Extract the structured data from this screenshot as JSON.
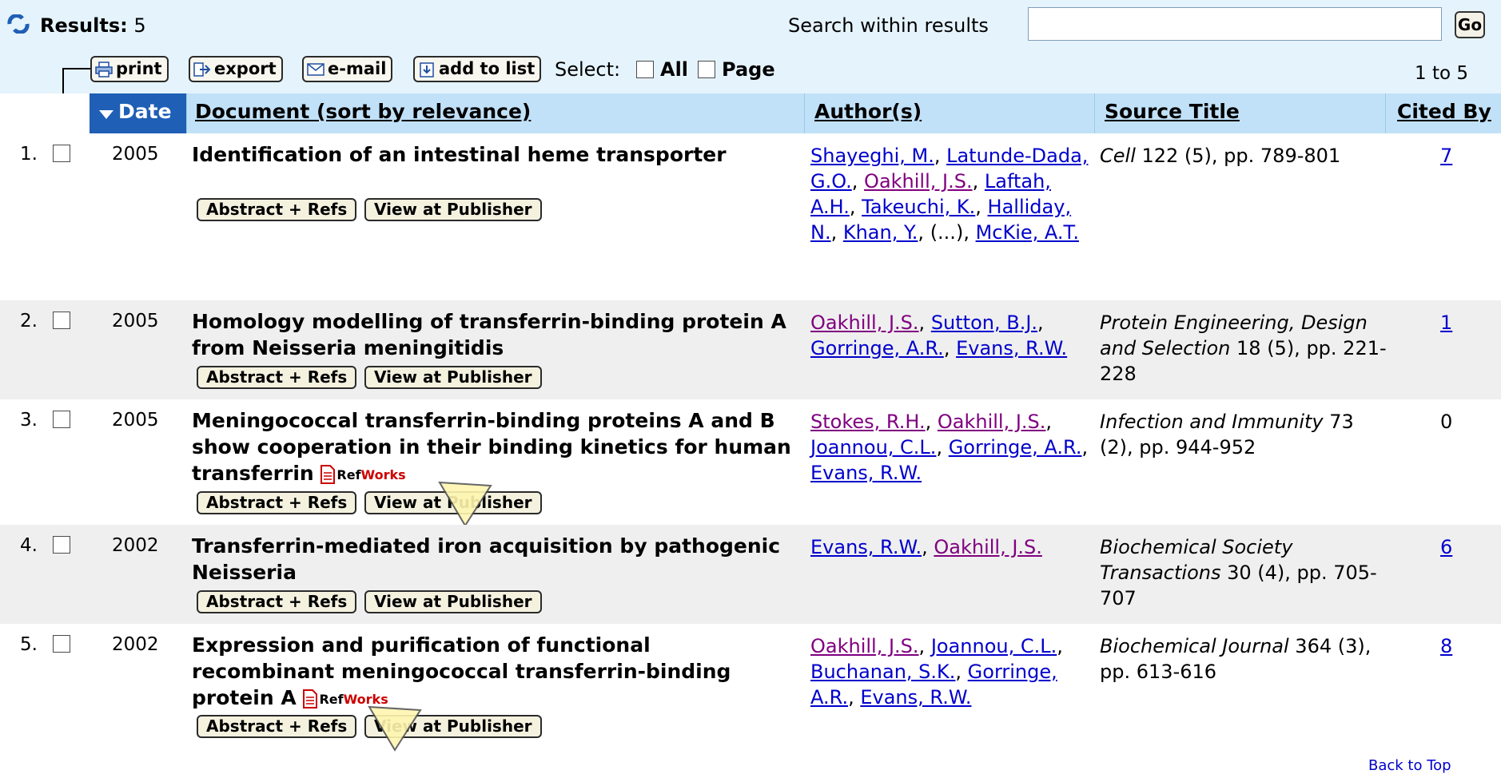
{
  "header": {
    "results_label": "Results:",
    "results_count": "5",
    "search_within_label": "Search within results",
    "search_value": "",
    "go_label": "Go"
  },
  "toolbar": {
    "print_label": "print",
    "export_label": "export",
    "email_label": "e-mail",
    "add_to_list_label": "add to list",
    "select_label": "Select:",
    "all_label": "All",
    "page_label": "Page",
    "range_label": "1 to 5"
  },
  "columns": {
    "date": "Date",
    "document": "Document (sort by relevance)",
    "authors": "Author(s)",
    "source": "Source Title",
    "cited_by": "Cited By"
  },
  "buttons": {
    "abstract_refs": "Abstract + Refs",
    "view_publisher": "View at Publisher"
  },
  "refworks": {
    "ref": "Ref",
    "works": "Works"
  },
  "rows": [
    {
      "num": "1.",
      "year": "2005",
      "title": "Identification of an intestinal heme transporter",
      "source_journal": "Cell",
      "source_rest": " 122 (5), pp. 789-801",
      "cited": "7"
    },
    {
      "num": "2.",
      "year": "2005",
      "title": "Homology modelling of transferrin-binding protein A from Neisseria meningitidis",
      "source_journal": "Protein Engineering, Design and Selection",
      "source_rest": " 18 (5), pp. 221-228",
      "cited": "1"
    },
    {
      "num": "3.",
      "year": "2005",
      "title": "Meningococcal transferrin-binding proteins A and B show cooperation in their binding kinetics for human transferrin",
      "source_journal": "Infection and Immunity",
      "source_rest": " 73 (2), pp. 944-952",
      "cited": "0"
    },
    {
      "num": "4.",
      "year": "2002",
      "title": "Transferrin-mediated iron acquisition by pathogenic Neisseria",
      "source_journal": "Biochemical Society Transactions",
      "source_rest": " 30 (4), pp. 705-707",
      "cited": "6"
    },
    {
      "num": "5.",
      "year": "2002",
      "title": "Expression and purification of functional recombinant meningococcal transferrin-binding protein A",
      "source_journal": "Biochemical Journal",
      "source_rest": " 364 (3), pp. 613-616",
      "cited": "8"
    }
  ],
  "authors": {
    "r1": [
      "Shayeghi, M.",
      "Latunde-Dada, G.O.",
      "Oakhill, J.S.",
      "Laftah, A.H.",
      "Takeuchi, K.",
      "Halliday, N.",
      "Khan, Y.",
      "(...)",
      "McKie, A.T."
    ],
    "r2": [
      "Oakhill, J.S.",
      "Sutton, B.J.",
      "Gorringe, A.R.",
      "Evans, R.W."
    ],
    "r3": [
      "Stokes, R.H.",
      "Oakhill, J.S.",
      "Joannou, C.L.",
      "Gorringe, A.R.",
      "Evans, R.W."
    ],
    "r4": [
      "Evans, R.W.",
      "Oakhill, J.S."
    ],
    "r5": [
      "Oakhill, J.S.",
      "Joannou, C.L.",
      "Buchanan, S.K.",
      "Gorringe, A.R.",
      "Evans, R.W."
    ]
  },
  "footer": {
    "back_to_top": "Back to Top"
  },
  "colors": {
    "header_bg": "#e5f3fd",
    "column_header_bg": "#c1e1f8",
    "sorted_col_bg": "#1f5fb6",
    "alt_row_bg": "#efefef",
    "link": "#0000cc",
    "visited_link": "#800080"
  }
}
